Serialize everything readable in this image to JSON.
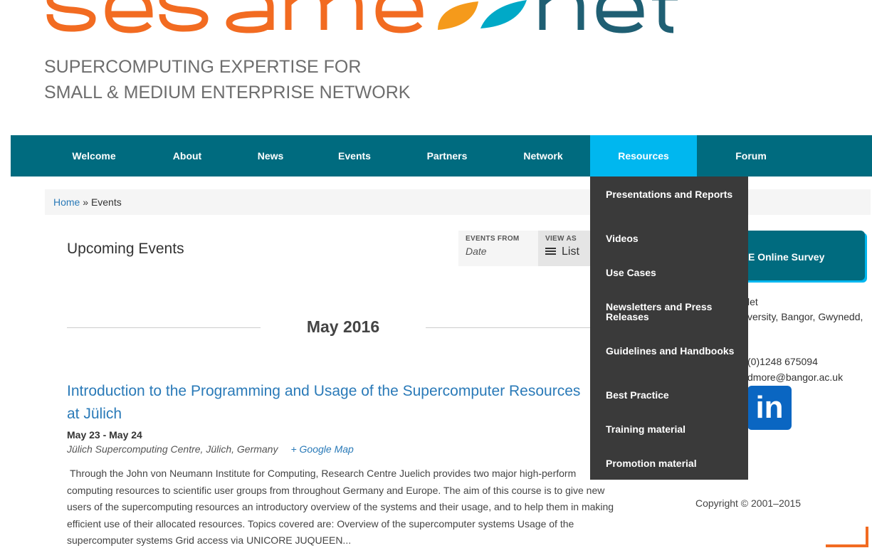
{
  "brand": {
    "tagline_line1": "SUPERCOMPUTING EXPERTISE FOR",
    "tagline_line2": "SMALL & MEDIUM ENTERPRISE NETWORK",
    "colors": {
      "orange": "#f26b21",
      "yellow_orange": "#f59a1b",
      "cyan": "#00a9c7",
      "teal": "#1f5f73"
    }
  },
  "nav": {
    "items": [
      {
        "label": "Welcome"
      },
      {
        "label": "About"
      },
      {
        "label": "News"
      },
      {
        "label": "Events"
      },
      {
        "label": "Partners"
      },
      {
        "label": "Network"
      },
      {
        "label": "Resources",
        "active": true
      },
      {
        "label": "Forum"
      }
    ],
    "colors": {
      "bar": "#006b7f",
      "active": "#00b7ef"
    }
  },
  "dropdown": {
    "items": [
      {
        "label": "Presentations and Reports"
      },
      {
        "label": "Videos"
      },
      {
        "label": "Use Cases"
      },
      {
        "label": "Newsletters and Press Releases"
      },
      {
        "label": "Guidelines and Handbooks"
      },
      {
        "label": "Best Practice"
      },
      {
        "label": "Training material"
      },
      {
        "label": "Promotion material"
      }
    ]
  },
  "breadcrumb": {
    "home": "Home",
    "separator": "»",
    "current": "Events"
  },
  "main": {
    "title": "Upcoming Events",
    "filter": {
      "events_from_label": "EVENTS FROM",
      "events_from_value": "Date",
      "view_as_label": "VIEW AS",
      "view_as_value": "List",
      "view_as_icon": "list-icon"
    },
    "month": "May 2016",
    "event": {
      "title": "Introduction to the Programming and Usage of the Supercomputer Resources at Jülich",
      "dates": "May 23 - May 24",
      "location": "Jülich Supercomputing Centre, Jülich, Germany",
      "map_link": "+ Google Map",
      "description": "Through the John von Neumann Institute for Computing, Research Centre Juelich provides two major high-perform computing resources to scientific user groups from throughout Germany and Europe. The aim of this course is to give new users of the supercomputing resources an introductory overview of the systems and their usage, and to help them in making efficient use of their allocated resources. Topics covered are: Overview of the supercomputer systems Usage of the supercomputer systems Grid access via UNICORE JUQUEEN..."
    }
  },
  "sidebar": {
    "survey_label": "E Online Survey",
    "contact_line1": "let",
    "contact_line2": "versity, Bangor, Gwynedd,",
    "phone": "(0)1248 675094",
    "email": "dmore@bangor.ac.uk",
    "linkedin_text": "in",
    "copyright": "Copyright © 2001–2015"
  }
}
